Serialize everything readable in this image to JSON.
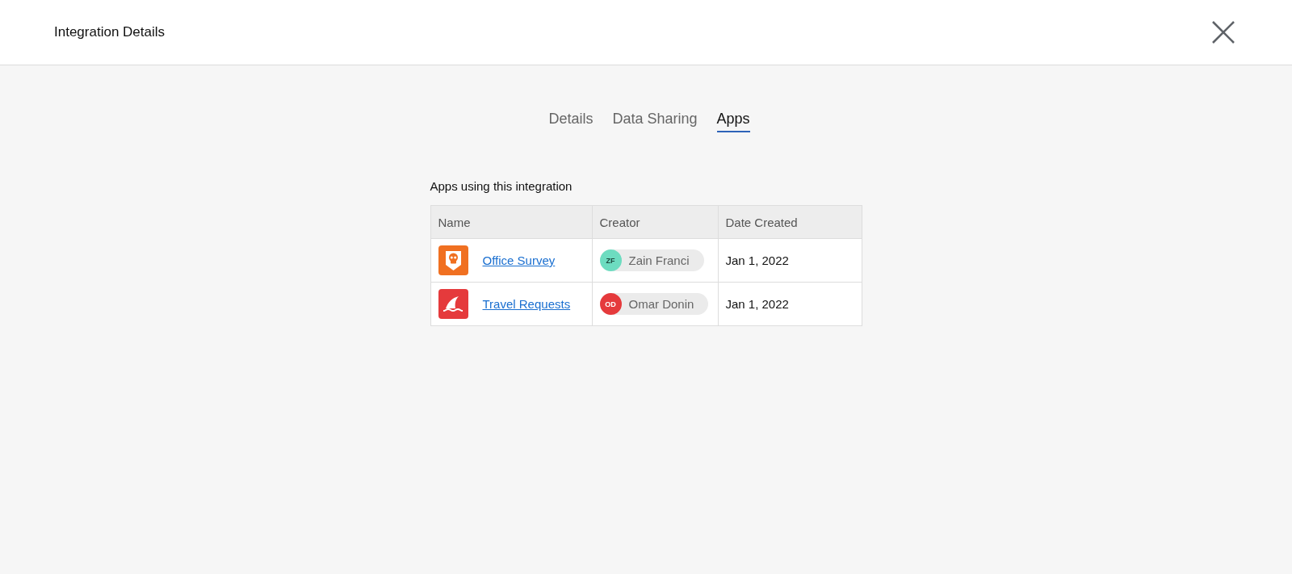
{
  "header": {
    "title": "Integration Details"
  },
  "tabs": [
    {
      "label": "Details",
      "selected": false
    },
    {
      "label": "Data Sharing",
      "selected": false
    },
    {
      "label": "Apps",
      "selected": true
    }
  ],
  "section_title": "Apps using this integration",
  "table": {
    "columns": [
      "Name",
      "Creator",
      "Date Created"
    ],
    "rows": [
      {
        "app": {
          "name": "Office Survey",
          "kind": "skull",
          "color": "#f07021"
        },
        "creator": {
          "initials": "ZF",
          "name": "Zain Franci",
          "color": "#6ddcc0"
        },
        "date": "Jan 1, 2022"
      },
      {
        "app": {
          "name": "Travel Requests",
          "kind": "shark",
          "color": "#e53a3c"
        },
        "creator": {
          "initials": "OD",
          "name": "Omar Donin",
          "color": "#e53a3c"
        },
        "date": "Jan 1, 2022"
      }
    ]
  }
}
